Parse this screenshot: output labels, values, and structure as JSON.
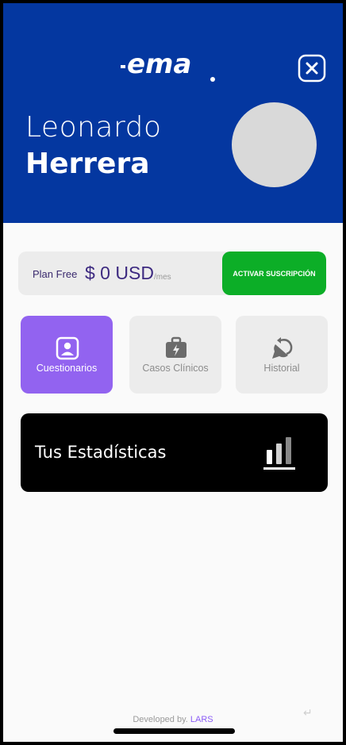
{
  "header": {
    "brand": "ema",
    "first_name": "Leonardo",
    "last_name": "Herrera",
    "close_icon": "close-icon",
    "bg_color": "#0437a0"
  },
  "plan": {
    "label": "Plan Free",
    "price": "$ 0 USD",
    "period": "/mes",
    "action_label": "ACTIVAR SUSCRIPCIÓN",
    "action_color": "#0cae27"
  },
  "tiles": [
    {
      "label": "Cuestionarios",
      "icon": "questionnaire-icon",
      "active": true
    },
    {
      "label": "Casos Clínicos",
      "icon": "medical-case-icon",
      "active": false
    },
    {
      "label": "Historial",
      "icon": "history-icon",
      "active": false
    }
  ],
  "stats": {
    "label": "Tus Estadísticas",
    "icon": "bar-chart-icon"
  },
  "footer": {
    "prefix": "Developed by.",
    "author": "LARS"
  },
  "accent_color": "#9263f0"
}
